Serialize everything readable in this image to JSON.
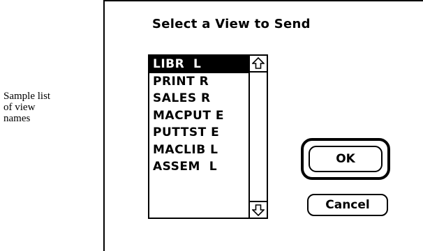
{
  "caption": "Sample list\nof view\nnames",
  "dialog": {
    "title": "Select a View to Send",
    "list": {
      "items": [
        "LIBR  L",
        "PRINT R",
        "SALES R",
        "MACPUT E",
        "PUTTST E",
        "MACLIB L",
        "ASSEM  L"
      ],
      "selected_index": 0
    },
    "scrollbar": {
      "up_icon": "arrow-up-icon",
      "down_icon": "arrow-down-icon"
    },
    "ok_label": "OK",
    "cancel_label": "Cancel"
  }
}
